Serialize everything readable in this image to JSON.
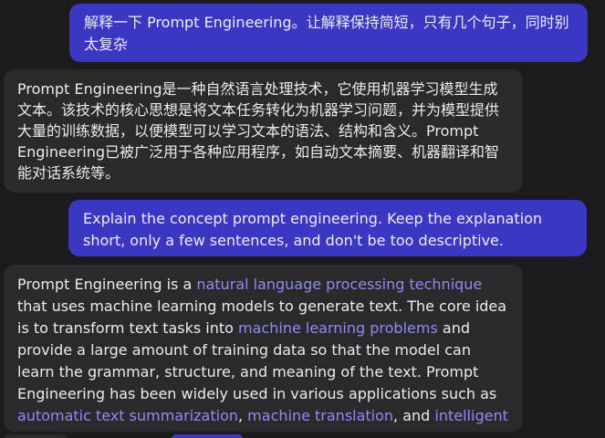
{
  "messages": [
    {
      "role": "user",
      "text": "解释一下 Prompt Engineering。让解释保持简短，只有几个句子，同时别太复杂"
    },
    {
      "role": "assistant",
      "text": "Prompt Engineering是一种自然语言处理技术，它使用机器学习模型生成文本。该技术的核心思想是将文本任务转化为机器学习问题，并为模型提供大量的训练数据，以便模型可以学习文本的语法、结构和含义。Prompt Engineering已被广泛用于各种应用程序，如自动文本摘要、机器翻译和智能对话系统等。"
    },
    {
      "role": "user",
      "text": "Explain the concept prompt engineering. Keep the explanation short, only a few sentences, and don't be too descriptive."
    },
    {
      "role": "assistant",
      "segments": [
        {
          "text": "Prompt Engineering is a ",
          "link": false
        },
        {
          "text": "natural language processing technique",
          "link": true
        },
        {
          "text": " that uses machine learning models to generate text. The core idea is to transform text tasks into ",
          "link": false
        },
        {
          "text": "machine learning problems",
          "link": true
        },
        {
          "text": " and provide a large amount of training data so that the model can learn the grammar, structure, and meaning of the text. Prompt Engineering has been widely used in various applications such as ",
          "link": false
        },
        {
          "text": "automatic text summarization",
          "link": true
        },
        {
          "text": ", ",
          "link": false
        },
        {
          "text": "machine translation",
          "link": true
        },
        {
          "text": ", and ",
          "link": false
        },
        {
          "text": "intelligent dialogue systems",
          "link": true
        },
        {
          "text": ".",
          "link": false
        }
      ]
    }
  ],
  "colors": {
    "user_bubble": "#3b37c3",
    "assistant_bubble": "#2a2a2d",
    "link": "#8e8cf2",
    "background": "#1b1b1d"
  }
}
